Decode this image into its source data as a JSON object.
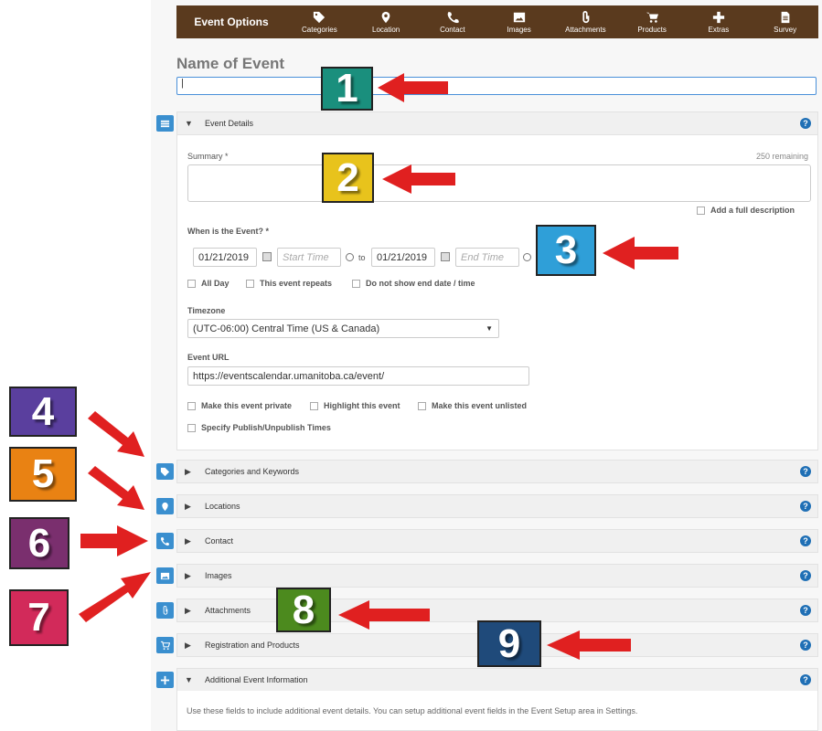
{
  "toolbar": {
    "title": "Event Options",
    "items": [
      {
        "label": "Categories",
        "icon": "tag-icon"
      },
      {
        "label": "Location",
        "icon": "map-pin-icon"
      },
      {
        "label": "Contact",
        "icon": "phone-icon"
      },
      {
        "label": "Images",
        "icon": "image-icon"
      },
      {
        "label": "Attachments",
        "icon": "paperclip-icon"
      },
      {
        "label": "Products",
        "icon": "cart-icon"
      },
      {
        "label": "Extras",
        "icon": "plus-icon"
      },
      {
        "label": "Survey",
        "icon": "document-icon"
      }
    ]
  },
  "event_name": {
    "label": "Name of Event",
    "value": "|"
  },
  "sections": {
    "details": "Event Details",
    "categories": "Categories and Keywords",
    "locations": "Locations",
    "contact": "Contact",
    "images": "Images",
    "attachments": "Attachments",
    "registration": "Registration and Products",
    "additional": "Additional Event Information"
  },
  "details": {
    "summary_label": "Summary *",
    "remaining": "250 remaining",
    "full_description": "Add a full description",
    "when_label": "When is the Event? *",
    "start_date": "01/21/2019",
    "start_time_placeholder": "Start Time",
    "to": "to",
    "end_date": "01/21/2019",
    "end_time_placeholder": "End Time",
    "all_day": "All Day",
    "repeats": "This event repeats",
    "no_end": "Do not show end date / time",
    "timezone_label": "Timezone",
    "timezone_value": "(UTC-06:00) Central Time (US & Canada)",
    "url_label": "Event URL",
    "url_value": "https://eventscalendar.umanitoba.ca/event/",
    "private": "Make this event private",
    "highlight": "Highlight this event",
    "unlisted": "Make this event unlisted",
    "publish": "Specify Publish/Unpublish Times"
  },
  "additional_text": "Use these fields to include additional event details. You can setup additional event fields in the Event Setup area in Settings.",
  "help": "?",
  "badges": {
    "b1": "1",
    "b2": "2",
    "b3": "3",
    "b4": "4",
    "b5": "5",
    "b6": "6",
    "b7": "7",
    "b8": "8",
    "b9": "9"
  },
  "colors": {
    "toolbar": "#5a3a1e",
    "badge1": "#1a8f7d",
    "badge2": "#e8c31c",
    "badge3": "#2f9fd8",
    "badge4": "#5a3f9e",
    "badge5": "#e98213",
    "badge6": "#7a2f6e",
    "badge7": "#d22a5a",
    "badge8": "#4c8a1e",
    "badge9": "#1f4a7a",
    "arrow": "#e02020"
  }
}
